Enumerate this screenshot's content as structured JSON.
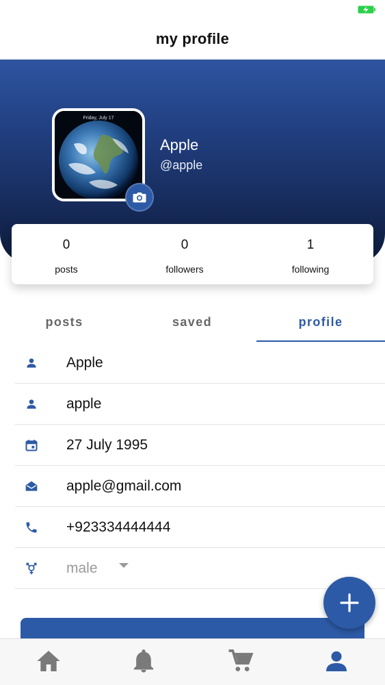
{
  "header": {
    "title": "my profile"
  },
  "profile": {
    "name": "Apple",
    "handle": "@apple"
  },
  "stats": [
    {
      "value": "0",
      "label": "posts"
    },
    {
      "value": "0",
      "label": "followers"
    },
    {
      "value": "1",
      "label": "following"
    }
  ],
  "tabs": [
    {
      "label": "posts",
      "active": false
    },
    {
      "label": "saved",
      "active": false
    },
    {
      "label": "profile",
      "active": true
    }
  ],
  "info": [
    {
      "icon": "person-icon",
      "text": "Apple"
    },
    {
      "icon": "person-icon",
      "text": "apple"
    },
    {
      "icon": "calendar-icon",
      "text": "27 July 1995"
    },
    {
      "icon": "mail-open-icon",
      "text": "apple@gmail.com"
    },
    {
      "icon": "phone-icon",
      "text": "+923334444444"
    },
    {
      "icon": "gender-icon",
      "text": "male"
    }
  ],
  "avatar": {
    "overlay_text": "Friday, July 17"
  },
  "colors": {
    "accent": "#2d5aa6",
    "hero_top": "#2e54a0",
    "hero_bottom": "#0d1a3a",
    "battery": "#2bd04a"
  },
  "bottom_nav": [
    "home-icon",
    "bell-icon",
    "cart-icon",
    "person-icon"
  ]
}
